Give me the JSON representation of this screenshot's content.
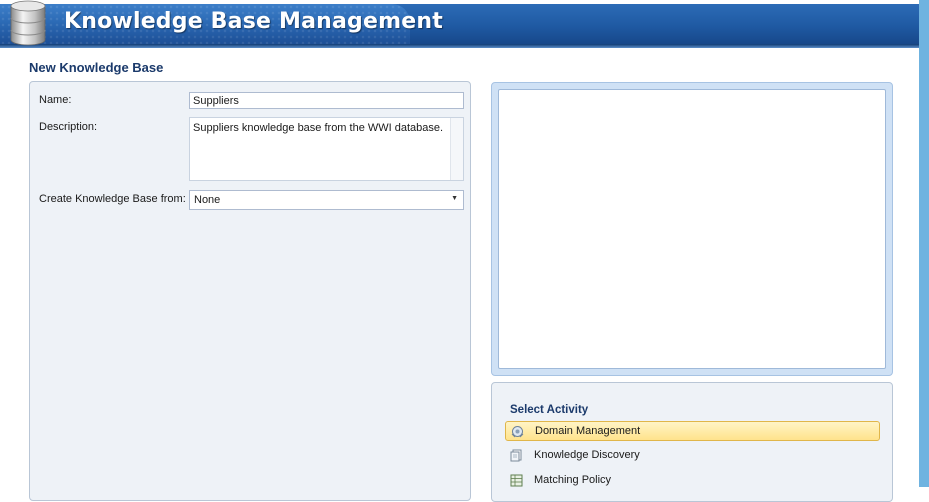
{
  "header": {
    "title": "Knowledge Base Management",
    "icon": "database-icon"
  },
  "page": {
    "section_title": "New Knowledge Base"
  },
  "form": {
    "name_label": "Name:",
    "name_value": "Suppliers",
    "description_label": "Description:",
    "description_value": "Suppliers knowledge base from the WWI database.",
    "create_from_label": "Create Knowledge Base from:",
    "create_from_value": "None",
    "create_from_arrow": "▼"
  },
  "activity": {
    "title": "Select Activity",
    "items": [
      {
        "label": "Domain Management",
        "icon": "domain-management-icon",
        "selected": true
      },
      {
        "label": "Knowledge Discovery",
        "icon": "knowledge-discovery-icon",
        "selected": false
      },
      {
        "label": "Matching Policy",
        "icon": "matching-policy-icon",
        "selected": false
      }
    ]
  },
  "colors": {
    "header_blue": "#1f5aa3",
    "section_title": "#1b3a6b",
    "selected_item": "#ffe38c",
    "right_edge": "#6fb3e0"
  }
}
